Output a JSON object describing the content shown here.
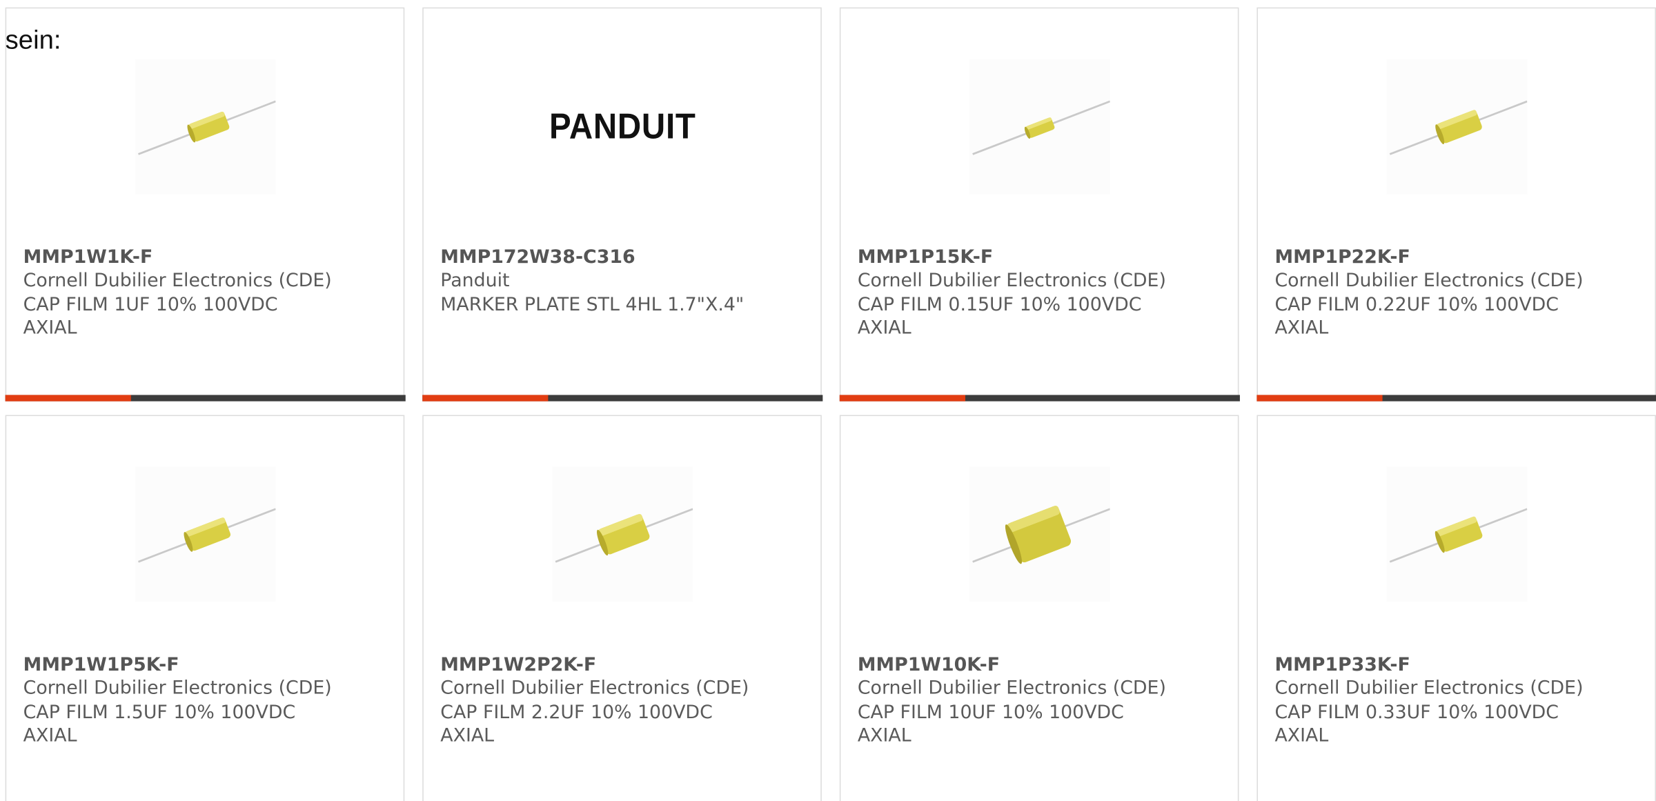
{
  "lead_text": "sein:",
  "colors": {
    "accent": "#e23d12",
    "bar": "#3c3c3c",
    "border": "#dcdcdc",
    "text": "#5a5a5a",
    "capacitor_body": "#d9cf44"
  },
  "products": [
    {
      "part_number": "MMP1W1K-F",
      "manufacturer": "Cornell Dubilier Electronics (CDE)",
      "description": "CAP FILM 1UF 10% 100VDC",
      "package": "AXIAL",
      "image": "axial-film-capacitor-icon"
    },
    {
      "part_number": "MMP172W38-C316",
      "manufacturer": "Panduit",
      "description": "MARKER PLATE STL 4HL 1.7\"X.4\"",
      "package": "",
      "image": "panduit-logo",
      "logo_text": "PANDUIT"
    },
    {
      "part_number": "MMP1P15K-F",
      "manufacturer": "Cornell Dubilier Electronics (CDE)",
      "description": "CAP FILM 0.15UF 10% 100VDC",
      "package": "AXIAL",
      "image": "axial-film-capacitor-icon"
    },
    {
      "part_number": "MMP1P22K-F",
      "manufacturer": "Cornell Dubilier Electronics (CDE)",
      "description": "CAP FILM 0.22UF 10% 100VDC",
      "package": "AXIAL",
      "image": "axial-film-capacitor-icon"
    },
    {
      "part_number": "MMP1W1P5K-F",
      "manufacturer": "Cornell Dubilier Electronics (CDE)",
      "description": "CAP FILM 1.5UF 10% 100VDC",
      "package": "AXIAL",
      "image": "axial-film-capacitor-icon"
    },
    {
      "part_number": "MMP1W2P2K-F",
      "manufacturer": "Cornell Dubilier Electronics (CDE)",
      "description": "CAP FILM 2.2UF 10% 100VDC",
      "package": "AXIAL",
      "image": "axial-film-capacitor-icon"
    },
    {
      "part_number": "MMP1W10K-F",
      "manufacturer": "Cornell Dubilier Electronics (CDE)",
      "description": "CAP FILM 10UF 10% 100VDC",
      "package": "AXIAL",
      "image": "axial-film-capacitor-icon"
    },
    {
      "part_number": "MMP1P33K-F",
      "manufacturer": "Cornell Dubilier Electronics (CDE)",
      "description": "CAP FILM 0.33UF 10% 100VDC",
      "package": "AXIAL",
      "image": "axial-film-capacitor-icon"
    }
  ]
}
